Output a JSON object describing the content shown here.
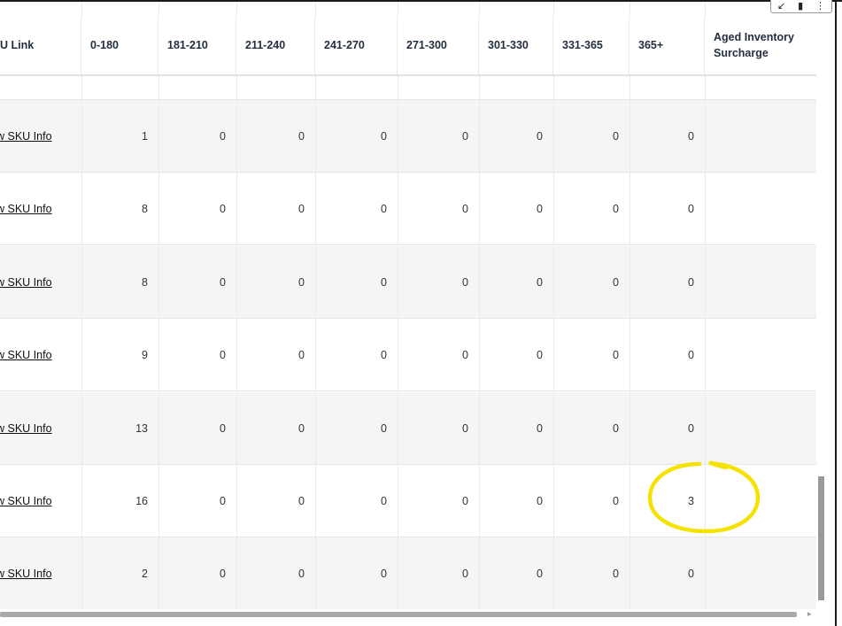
{
  "columns": [
    "U Link",
    "0-180",
    "181-210",
    "211-240",
    "241-270",
    "271-300",
    "301-330",
    "331-365",
    "365+",
    "Aged Inventory Surcharge"
  ],
  "rows": [
    {
      "link": "w SKU Info",
      "values": [
        "1",
        "0",
        "0",
        "0",
        "0",
        "0",
        "0",
        "0"
      ],
      "surcharge": ""
    },
    {
      "link": "w SKU Info",
      "values": [
        "8",
        "0",
        "0",
        "0",
        "0",
        "0",
        "0",
        "0"
      ],
      "surcharge": ""
    },
    {
      "link": "w SKU Info",
      "values": [
        "8",
        "0",
        "0",
        "0",
        "0",
        "0",
        "0",
        "0"
      ],
      "surcharge": ""
    },
    {
      "link": "w SKU Info",
      "values": [
        "9",
        "0",
        "0",
        "0",
        "0",
        "0",
        "0",
        "0"
      ],
      "surcharge": ""
    },
    {
      "link": "w SKU Info",
      "values": [
        "13",
        "0",
        "0",
        "0",
        "0",
        "0",
        "0",
        "0"
      ],
      "surcharge": ""
    },
    {
      "link": "w SKU Info",
      "values": [
        "16",
        "0",
        "0",
        "0",
        "0",
        "0",
        "0",
        "3"
      ],
      "surcharge": ""
    },
    {
      "link": "w SKU Info",
      "values": [
        "2",
        "0",
        "0",
        "0",
        "0",
        "0",
        "0",
        "0"
      ],
      "surcharge": ""
    }
  ],
  "icons": {
    "toolbar": [
      "expand-icon",
      "cursor-icon",
      "more-options-icon"
    ]
  },
  "colors": {
    "annotation": "#f5e200",
    "shaded_row": "#f5f5f5",
    "header_text": "#232f3e"
  },
  "annotation": {
    "highlighted_cell": "365+",
    "highlighted_row": 6
  }
}
